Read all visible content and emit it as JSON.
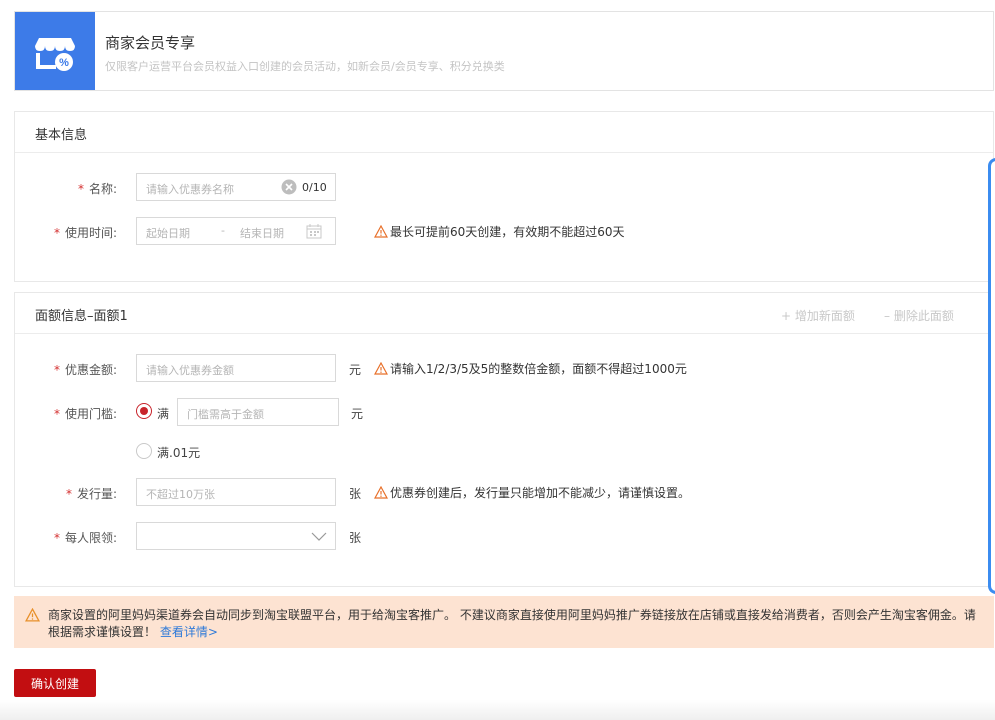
{
  "header": {
    "icon": "store-discount-icon",
    "title": "商家会员专享",
    "description": "仅限客户运营平台会员权益入口创建的会员活动，如新会员/会员专享、积分兑换类"
  },
  "basic_info": {
    "title": "基本信息",
    "name": {
      "label": "名称:",
      "placeholder": "请输入优惠券名称",
      "counter": "0/10"
    },
    "time": {
      "label": "使用时间:",
      "start_placeholder": "起始日期",
      "separator": "-",
      "end_placeholder": "结束日期",
      "hint": "最长可提前60天创建，有效期不能超过60天"
    }
  },
  "denomination": {
    "title": "面额信息–面额1",
    "add_label": "+ 增加新面额",
    "delete_label": "– 删除此面额",
    "amount": {
      "label": "优惠金额:",
      "placeholder": "请输入优惠券金额",
      "unit": "元",
      "hint": "请输入1/2/3/5及5的整数倍金额，面额不得超过1000元"
    },
    "threshold": {
      "label": "使用门槛:",
      "option1": "满",
      "option1_placeholder": "门槛需高于金额",
      "unit": "元",
      "option2": "满.01元",
      "selected": "option1"
    },
    "quantity": {
      "label": "发行量:",
      "placeholder": "不超过10万张",
      "unit": "张",
      "hint": "优惠券创建后，发行量只能增加不能减少，请谨慎设置。"
    },
    "limit": {
      "label": "每人限领:",
      "value": "",
      "unit": "张"
    }
  },
  "notice": {
    "text": "商家设置的阿里妈妈渠道券会自动同步到淘宝联盟平台，用于给淘宝客推广。 不建议商家直接使用阿里妈妈推广券链接放在店铺或直接发给消费者，否则会产生淘宝客佣金。请根据需求谨慎设置！",
    "link": "查看详情>"
  },
  "submit_label": "确认创建",
  "colors": {
    "accent": "#c20e11",
    "header_icon_bg": "#3d7be8",
    "warning": "#e8702a",
    "notice_bg": "#fde3d2"
  }
}
